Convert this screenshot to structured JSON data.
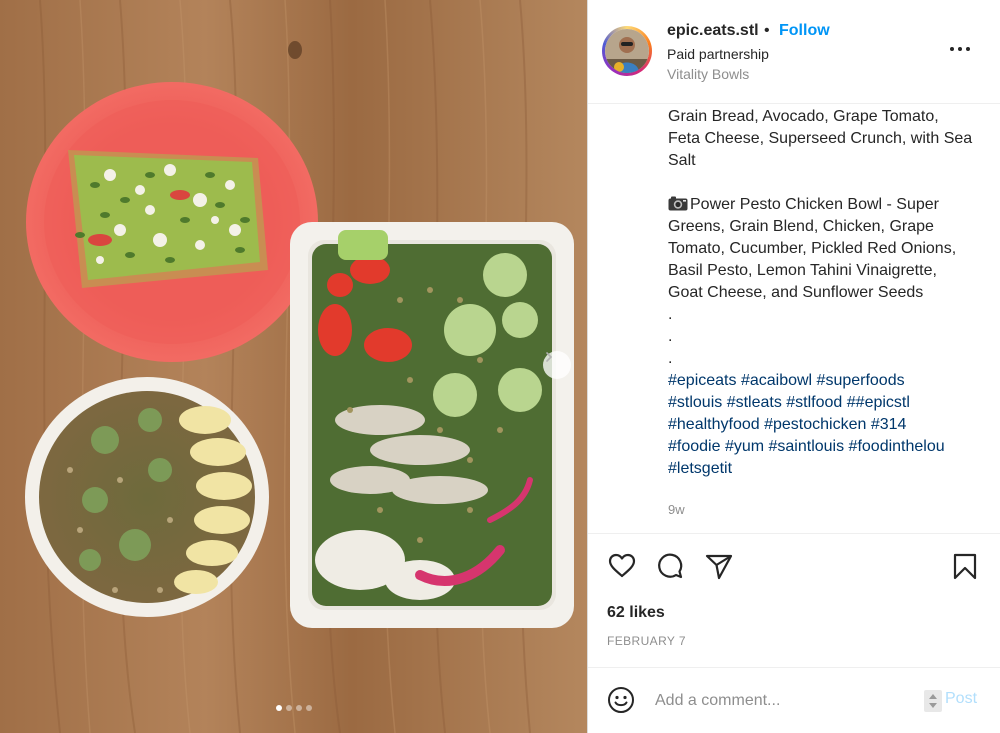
{
  "post": {
    "username": "epic.eats.stl",
    "bullet": "•",
    "follow_label": "Follow",
    "partnership": "Paid partnership",
    "location": "Vitality Bowls",
    "caption_lines": [
      "Grain Bread, Avocado, Grape Tomato,",
      "Feta Cheese, Superseed Crunch, with Sea",
      "Salt"
    ],
    "caption2_first": "Power Pesto Chicken Bowl - Super",
    "caption2_lines": [
      "Greens, Grain Blend, Chicken, Grape",
      "Tomato, Cucumber, Pickled Red Onions,",
      "Basil Pesto, Lemon Tahini Vinaigrette,",
      "Goat Cheese, and Sunflower Seeds"
    ],
    "dots": [
      ".",
      ".",
      "."
    ],
    "hashtag_lines": [
      "#epiceats #acaibowl #superfoods",
      "#stlouis #stleats #stlfood ##epicstl",
      "#healthyfood #pestochicken #314",
      "#foodie #yum #saintlouis #foodinthelou",
      "#letsgetit"
    ],
    "time_ago": "9w",
    "likes": "62 likes",
    "date": "FEBRUARY 7"
  },
  "comment": {
    "placeholder": "Add a comment...",
    "post_label": "Post"
  },
  "icons": {
    "more": "more-options-icon",
    "like": "heart-icon",
    "comment": "comment-icon",
    "share": "paper-plane-icon",
    "save": "bookmark-icon",
    "emoji": "smiley-icon",
    "camera": "camera-emoji-icon",
    "next": "chevron-right-icon"
  },
  "carousel": {
    "count": 4,
    "active_index": 0
  },
  "colors": {
    "link_blue": "#0095f6",
    "hashtag": "#00376b",
    "muted": "#8e8e8e",
    "post_disabled": "#b2dffc"
  }
}
